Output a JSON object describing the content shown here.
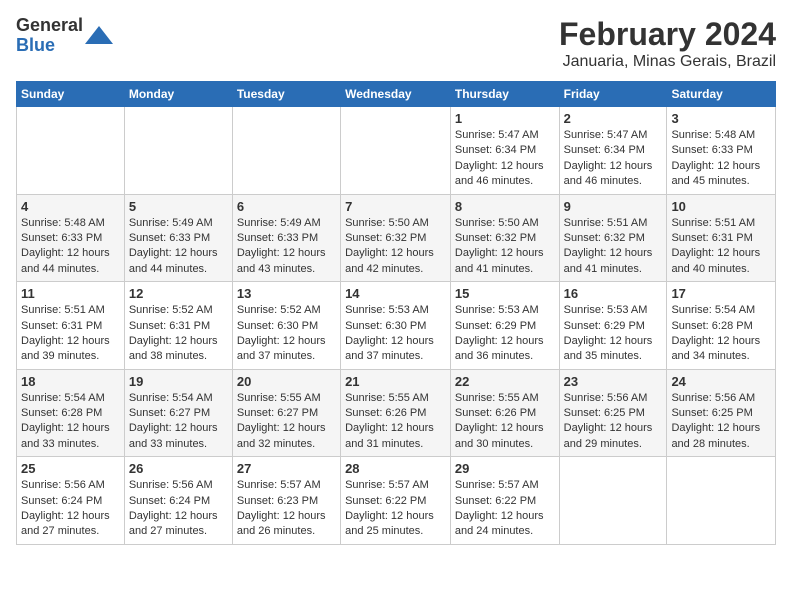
{
  "logo": {
    "general": "General",
    "blue": "Blue"
  },
  "title": {
    "month_year": "February 2024",
    "location": "Januaria, Minas Gerais, Brazil"
  },
  "weekdays": [
    "Sunday",
    "Monday",
    "Tuesday",
    "Wednesday",
    "Thursday",
    "Friday",
    "Saturday"
  ],
  "weeks": [
    [
      {
        "day": "",
        "info": ""
      },
      {
        "day": "",
        "info": ""
      },
      {
        "day": "",
        "info": ""
      },
      {
        "day": "",
        "info": ""
      },
      {
        "day": "1",
        "info": "Sunrise: 5:47 AM\nSunset: 6:34 PM\nDaylight: 12 hours and 46 minutes."
      },
      {
        "day": "2",
        "info": "Sunrise: 5:47 AM\nSunset: 6:34 PM\nDaylight: 12 hours and 46 minutes."
      },
      {
        "day": "3",
        "info": "Sunrise: 5:48 AM\nSunset: 6:33 PM\nDaylight: 12 hours and 45 minutes."
      }
    ],
    [
      {
        "day": "4",
        "info": "Sunrise: 5:48 AM\nSunset: 6:33 PM\nDaylight: 12 hours and 44 minutes."
      },
      {
        "day": "5",
        "info": "Sunrise: 5:49 AM\nSunset: 6:33 PM\nDaylight: 12 hours and 44 minutes."
      },
      {
        "day": "6",
        "info": "Sunrise: 5:49 AM\nSunset: 6:33 PM\nDaylight: 12 hours and 43 minutes."
      },
      {
        "day": "7",
        "info": "Sunrise: 5:50 AM\nSunset: 6:32 PM\nDaylight: 12 hours and 42 minutes."
      },
      {
        "day": "8",
        "info": "Sunrise: 5:50 AM\nSunset: 6:32 PM\nDaylight: 12 hours and 41 minutes."
      },
      {
        "day": "9",
        "info": "Sunrise: 5:51 AM\nSunset: 6:32 PM\nDaylight: 12 hours and 41 minutes."
      },
      {
        "day": "10",
        "info": "Sunrise: 5:51 AM\nSunset: 6:31 PM\nDaylight: 12 hours and 40 minutes."
      }
    ],
    [
      {
        "day": "11",
        "info": "Sunrise: 5:51 AM\nSunset: 6:31 PM\nDaylight: 12 hours and 39 minutes."
      },
      {
        "day": "12",
        "info": "Sunrise: 5:52 AM\nSunset: 6:31 PM\nDaylight: 12 hours and 38 minutes."
      },
      {
        "day": "13",
        "info": "Sunrise: 5:52 AM\nSunset: 6:30 PM\nDaylight: 12 hours and 37 minutes."
      },
      {
        "day": "14",
        "info": "Sunrise: 5:53 AM\nSunset: 6:30 PM\nDaylight: 12 hours and 37 minutes."
      },
      {
        "day": "15",
        "info": "Sunrise: 5:53 AM\nSunset: 6:29 PM\nDaylight: 12 hours and 36 minutes."
      },
      {
        "day": "16",
        "info": "Sunrise: 5:53 AM\nSunset: 6:29 PM\nDaylight: 12 hours and 35 minutes."
      },
      {
        "day": "17",
        "info": "Sunrise: 5:54 AM\nSunset: 6:28 PM\nDaylight: 12 hours and 34 minutes."
      }
    ],
    [
      {
        "day": "18",
        "info": "Sunrise: 5:54 AM\nSunset: 6:28 PM\nDaylight: 12 hours and 33 minutes."
      },
      {
        "day": "19",
        "info": "Sunrise: 5:54 AM\nSunset: 6:27 PM\nDaylight: 12 hours and 33 minutes."
      },
      {
        "day": "20",
        "info": "Sunrise: 5:55 AM\nSunset: 6:27 PM\nDaylight: 12 hours and 32 minutes."
      },
      {
        "day": "21",
        "info": "Sunrise: 5:55 AM\nSunset: 6:26 PM\nDaylight: 12 hours and 31 minutes."
      },
      {
        "day": "22",
        "info": "Sunrise: 5:55 AM\nSunset: 6:26 PM\nDaylight: 12 hours and 30 minutes."
      },
      {
        "day": "23",
        "info": "Sunrise: 5:56 AM\nSunset: 6:25 PM\nDaylight: 12 hours and 29 minutes."
      },
      {
        "day": "24",
        "info": "Sunrise: 5:56 AM\nSunset: 6:25 PM\nDaylight: 12 hours and 28 minutes."
      }
    ],
    [
      {
        "day": "25",
        "info": "Sunrise: 5:56 AM\nSunset: 6:24 PM\nDaylight: 12 hours and 27 minutes."
      },
      {
        "day": "26",
        "info": "Sunrise: 5:56 AM\nSunset: 6:24 PM\nDaylight: 12 hours and 27 minutes."
      },
      {
        "day": "27",
        "info": "Sunrise: 5:57 AM\nSunset: 6:23 PM\nDaylight: 12 hours and 26 minutes."
      },
      {
        "day": "28",
        "info": "Sunrise: 5:57 AM\nSunset: 6:22 PM\nDaylight: 12 hours and 25 minutes."
      },
      {
        "day": "29",
        "info": "Sunrise: 5:57 AM\nSunset: 6:22 PM\nDaylight: 12 hours and 24 minutes."
      },
      {
        "day": "",
        "info": ""
      },
      {
        "day": "",
        "info": ""
      }
    ]
  ]
}
